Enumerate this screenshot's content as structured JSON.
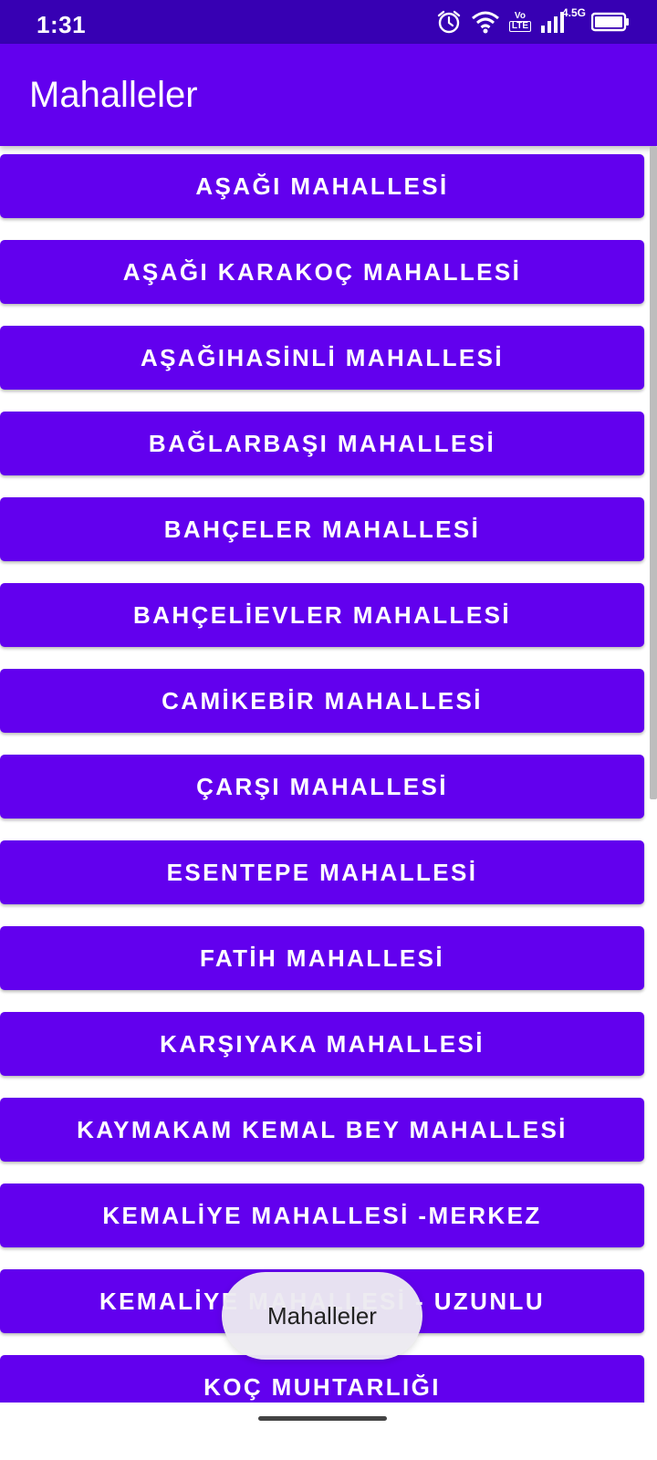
{
  "status_bar": {
    "time": "1:31",
    "network_label": "4.5G",
    "volte_top": "Vo",
    "volte_bottom": "LTE",
    "icons": [
      "alarm-icon",
      "wifi-icon",
      "volte-icon",
      "signal-icon",
      "battery-icon"
    ]
  },
  "app_bar": {
    "title": "Mahalleler"
  },
  "list": {
    "items": [
      "AŞAĞI MAHALLESİ",
      "AŞAĞI KARAKOÇ MAHALLESİ",
      "AŞAĞIHASİNLİ MAHALLESİ",
      "BAĞLARBAŞI MAHALLESİ",
      "BAHÇELER MAHALLESİ",
      "BAHÇELİEVLER MAHALLESİ",
      "CAMİKEBİR MAHALLESİ",
      "ÇARŞI MAHALLESİ",
      "ESENTEPE MAHALLESİ",
      "FATİH MAHALLESİ",
      "KARŞIYAKA MAHALLESİ",
      "KAYMAKAM KEMAL BEY MAHALLESİ",
      "KEMALİYE MAHALLESİ -MERKEZ",
      "KEMALİYE MAHALLESİ - UZUNLU",
      "KOÇ MUHTARLIĞI"
    ]
  },
  "toast": {
    "text": "Mahalleler"
  },
  "colors": {
    "status_bar": "#3700B3",
    "primary": "#6200EE",
    "button_text": "#FFFFFF",
    "toast_bg": "#ECEAF0"
  }
}
